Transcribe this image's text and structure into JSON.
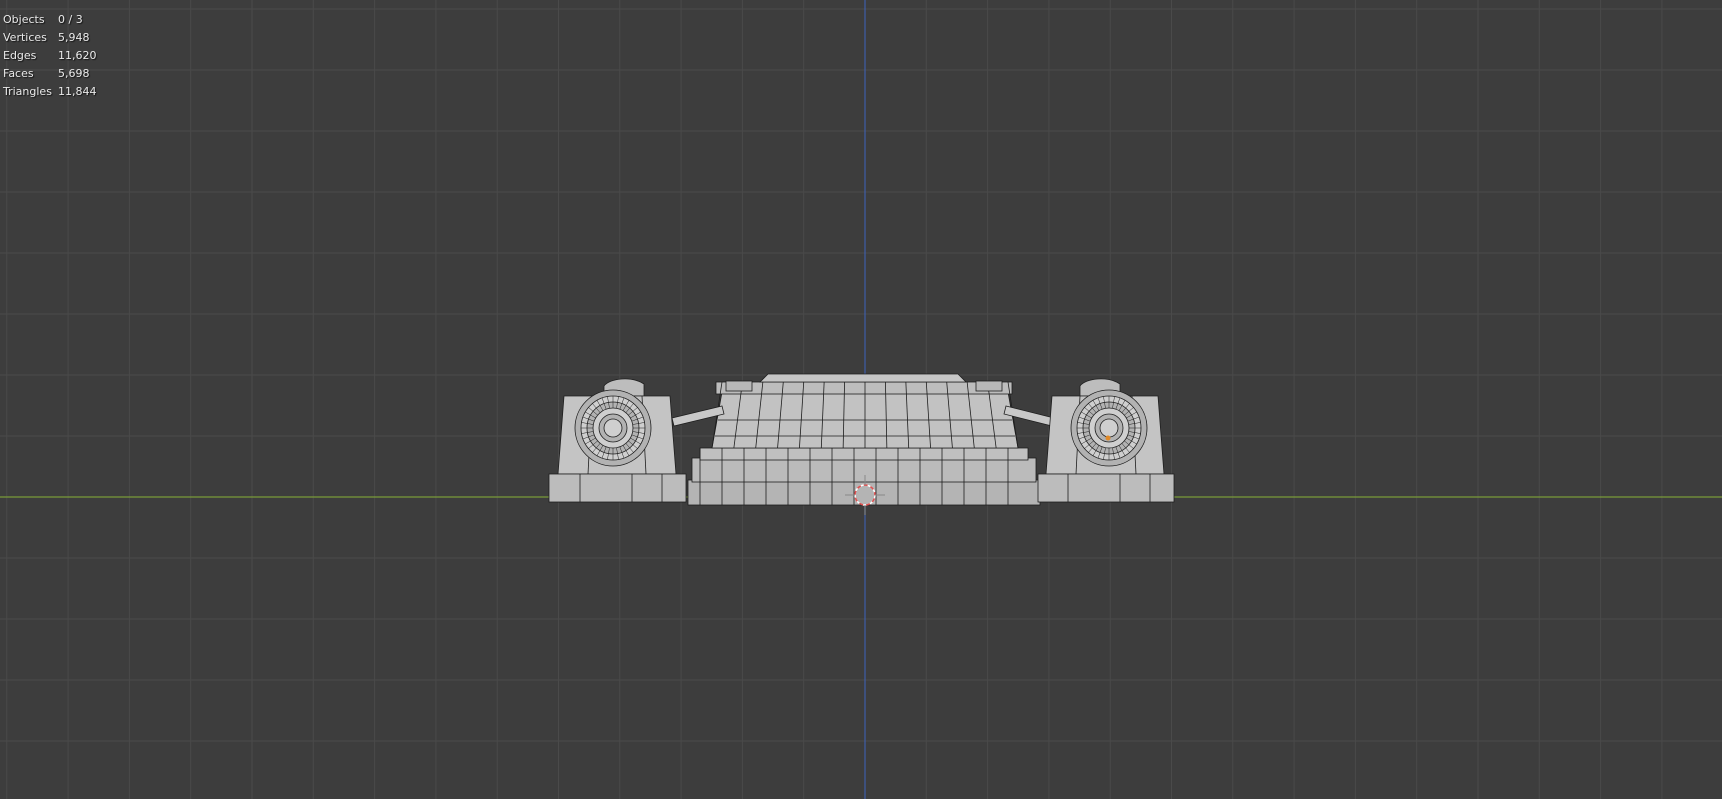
{
  "stats": {
    "objects_label": "Objects",
    "objects_value": "0 / 3",
    "vertices_label": "Vertices",
    "vertices_value": "5,948",
    "edges_label": "Edges",
    "edges_value": "11,620",
    "faces_label": "Faces",
    "faces_value": "5,698",
    "triangles_label": "Triangles",
    "triangles_value": "11,844"
  },
  "colors": {
    "background": "#3d3d3d",
    "grid_line": "#4a4a4a",
    "x_axis": "#7a9a3a",
    "z_axis": "#3e5ea8",
    "mesh_fill": "#b9b9b9",
    "wire": "#1e1e1e",
    "cursor_red": "#e05050"
  }
}
